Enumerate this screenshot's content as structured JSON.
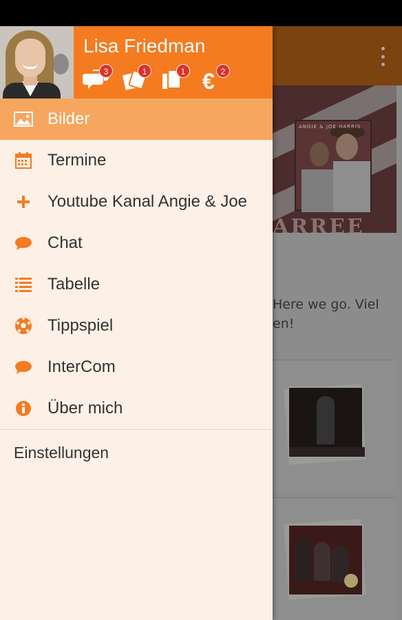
{
  "user": {
    "name": "Lisa Friedman"
  },
  "header_icons": [
    {
      "icon": "chat-bubbles-icon",
      "badge": "3"
    },
    {
      "icon": "tickets-icon",
      "badge": "1"
    },
    {
      "icon": "documents-icon",
      "badge": "1"
    },
    {
      "icon": "euro-icon",
      "badge": "2"
    }
  ],
  "menu": {
    "items": [
      {
        "label": "Bilder",
        "icon": "image-icon",
        "active": true
      },
      {
        "label": "Termine",
        "icon": "calendar-icon"
      },
      {
        "label": "Youtube Kanal Angie & Joe",
        "icon": "plus-icon"
      },
      {
        "label": "Chat",
        "icon": "chat-icon"
      },
      {
        "label": "Tabelle",
        "icon": "list-icon"
      },
      {
        "label": "Tippspiel",
        "icon": "soccer-ball-icon"
      },
      {
        "label": "InterCom",
        "icon": "chat-icon"
      },
      {
        "label": "Über mich",
        "icon": "info-icon"
      }
    ],
    "settings_label": "Einstellungen"
  },
  "background": {
    "post_text_line1": "Here we go. Viel",
    "post_text_line2": "en!",
    "banner_text": "ANGIE & JOE HARRIS",
    "banner_letters": "ARREE"
  },
  "colors": {
    "accent": "#f47b20",
    "active_item": "#f7a65f",
    "drawer_bg": "#fdf0e6",
    "badge": "#e0302a"
  }
}
